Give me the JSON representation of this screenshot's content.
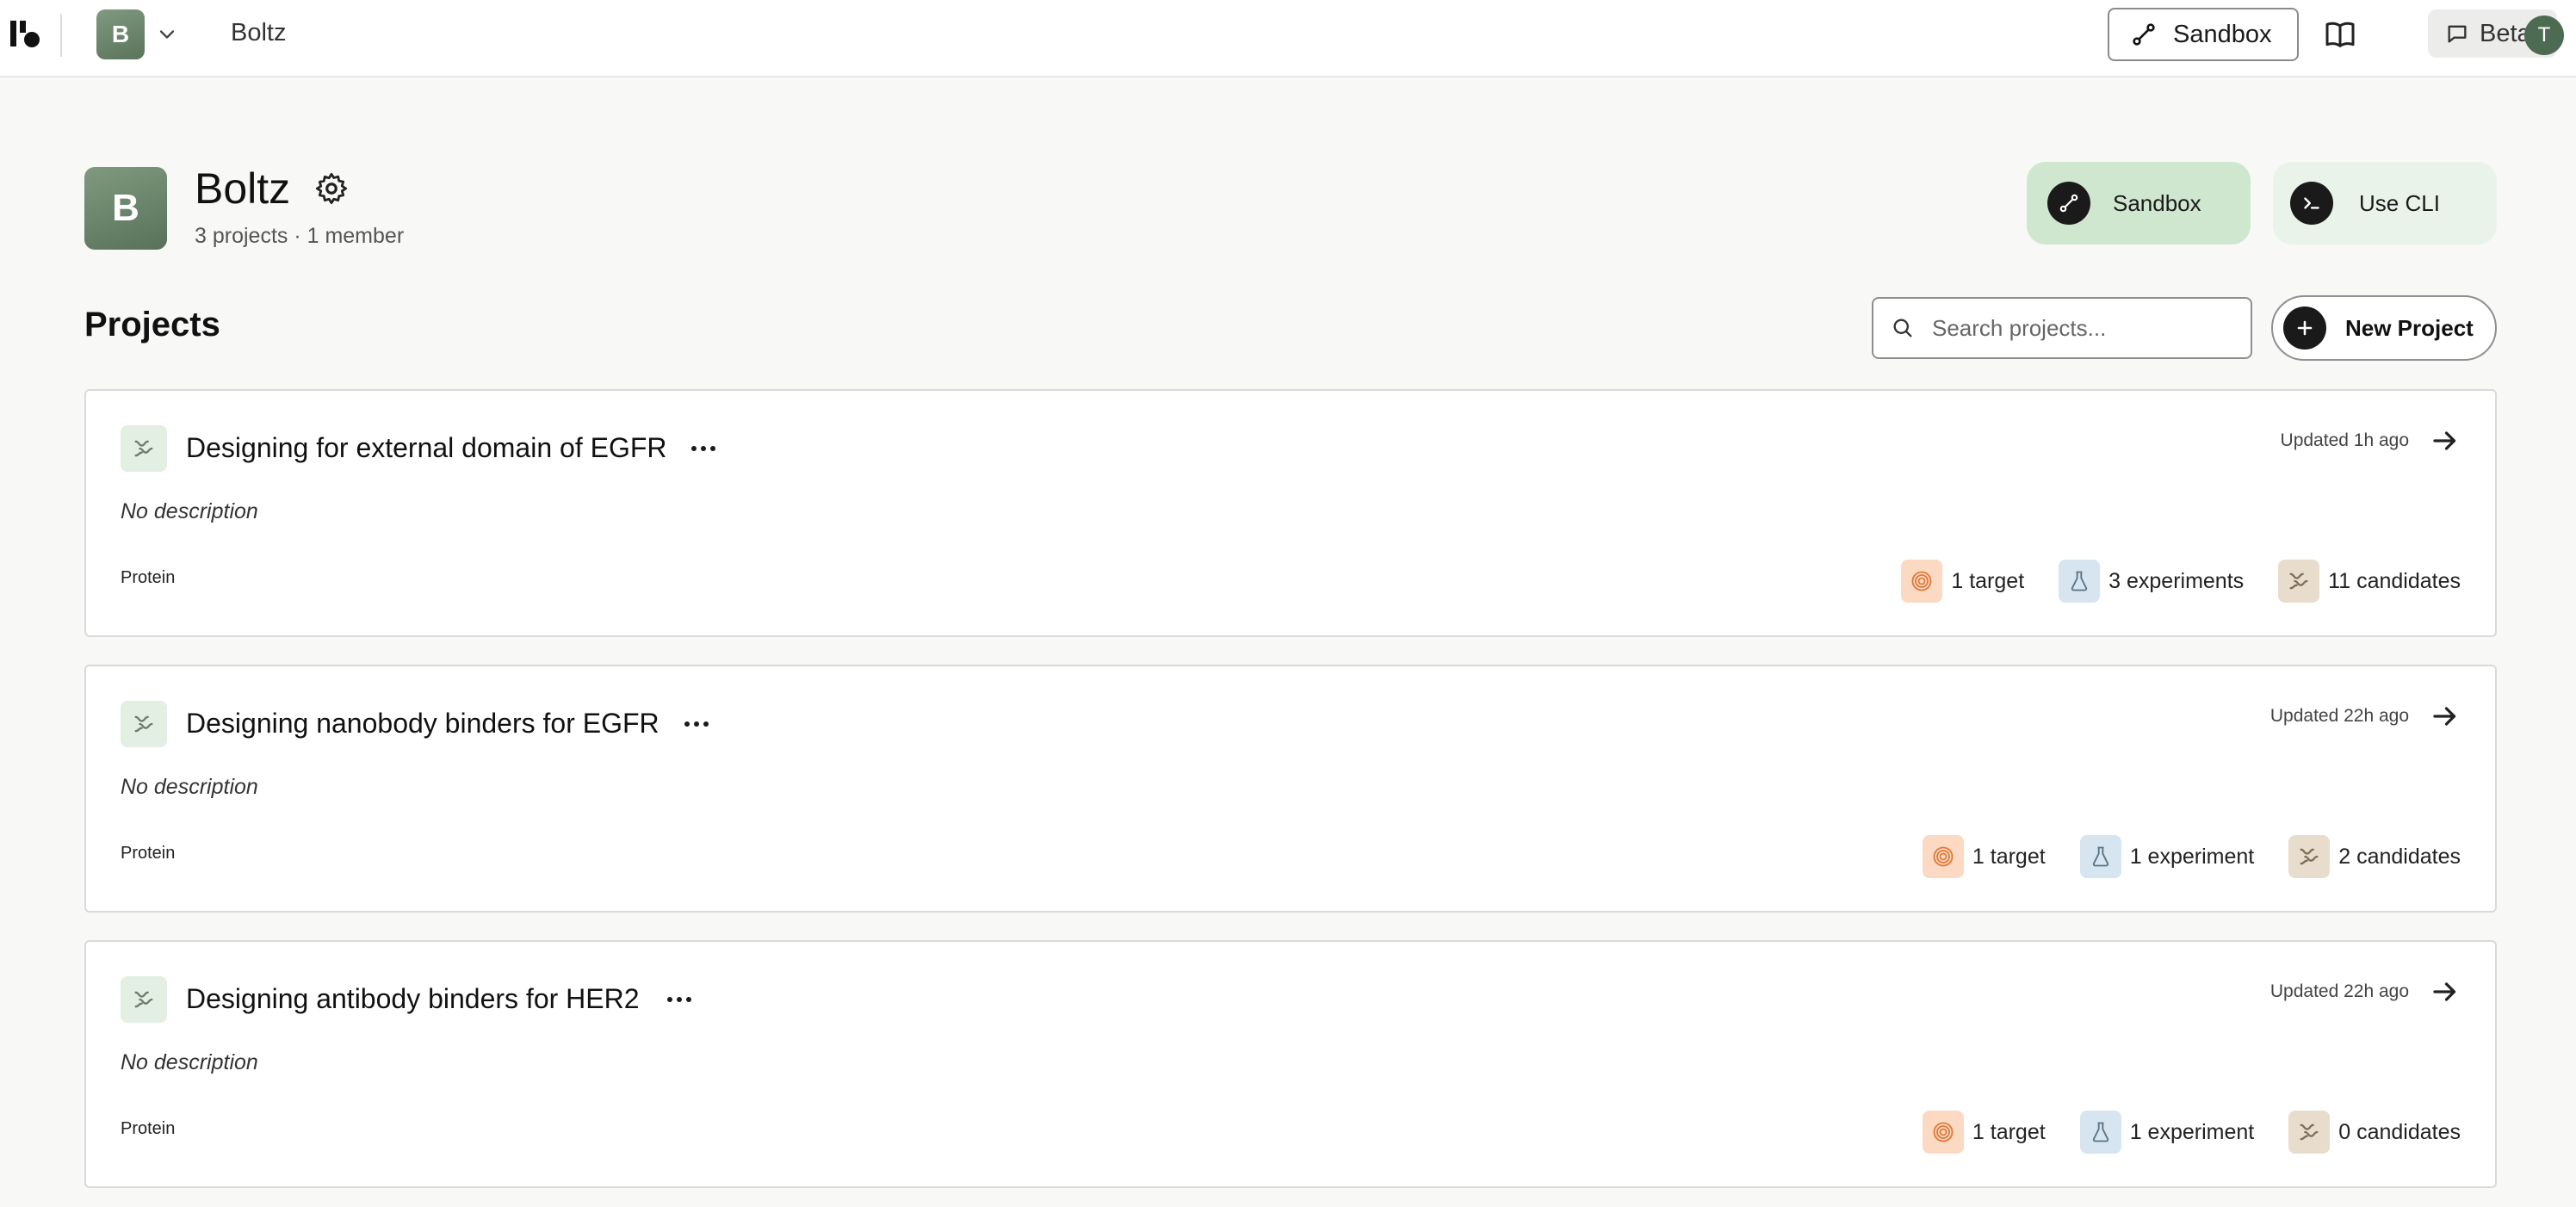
{
  "topbar": {
    "org_initial": "B",
    "org_name": "Boltz",
    "sandbox_label": "Sandbox",
    "beta_label": "Beta",
    "user_initial": "T"
  },
  "header": {
    "org_initial": "B",
    "org_name": "Boltz",
    "meta": "3 projects · 1 member",
    "sandbox_label": "Sandbox",
    "cli_label": "Use CLI"
  },
  "projects_section": {
    "title": "Projects",
    "search_placeholder": "Search projects...",
    "new_project_label": "New Project"
  },
  "projects": [
    {
      "title": "Designing for external domain of EGFR",
      "updated": "Updated 1h ago",
      "description": "No description",
      "type": "Protein",
      "targets": "1 target",
      "experiments": "3 experiments",
      "candidates": "11 candidates"
    },
    {
      "title": "Designing nanobody binders for EGFR",
      "updated": "Updated 22h ago",
      "description": "No description",
      "type": "Protein",
      "targets": "1 target",
      "experiments": "1 experiment",
      "candidates": "2 candidates"
    },
    {
      "title": "Designing antibody binders for HER2",
      "updated": "Updated 22h ago",
      "description": "No description",
      "type": "Protein",
      "targets": "1 target",
      "experiments": "1 experiment",
      "candidates": "0 candidates"
    }
  ],
  "icons": {
    "logo": "boltz-logo-icon",
    "chevron": "chevron-down-icon",
    "sandbox": "sandbox-icon",
    "book": "book-icon",
    "beta": "chat-bubble-icon",
    "settings": "gear-icon",
    "terminal": "terminal-icon",
    "search": "search-icon",
    "add": "plus-icon",
    "project": "protein-icon",
    "more": "more-dots-icon",
    "arrow": "arrow-right-icon",
    "target": "target-icon",
    "experiment": "flask-icon",
    "candidate": "protein-icon"
  },
  "colors": {
    "accent_green": "#cfe6cf",
    "org_badge": "#6b866d",
    "target_bg": "#fbd9c2",
    "experiment_bg": "#d6e5ef",
    "candidate_bg": "#e8ddcc"
  }
}
